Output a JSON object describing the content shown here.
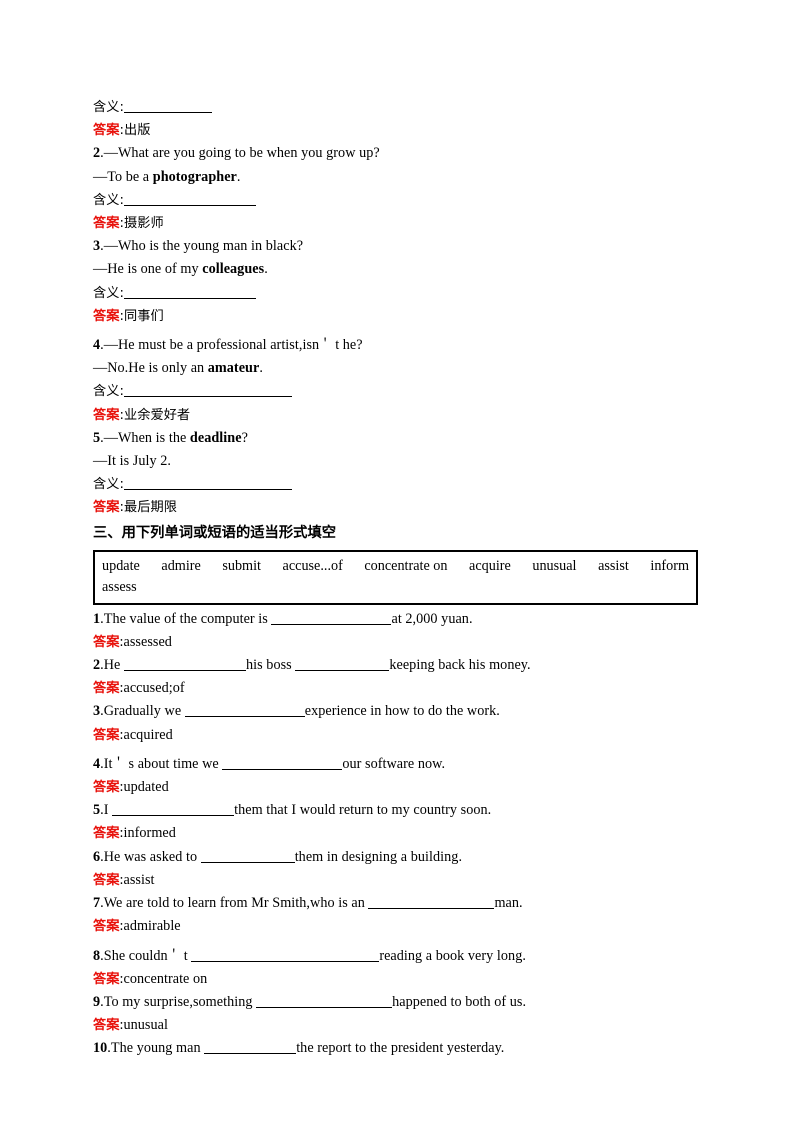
{
  "meaning_label": "含义:",
  "answer_label": "答案",
  "colon": ":",
  "section_two_tail": {
    "q1_answer": "出版"
  },
  "vocab_items": [
    {
      "number": "2",
      "question": ".—What are you going to be when you grow up?",
      "reply_prefix": "—To be a ",
      "reply_bold": "photographer",
      "reply_suffix": ".",
      "answer": "摄影师"
    },
    {
      "number": "3",
      "question": ".—Who is the young man in black?",
      "reply_prefix": "—He is one of my ",
      "reply_bold": "colleagues",
      "reply_suffix": ".",
      "answer": "同事们"
    },
    {
      "number": "4",
      "question_pre": ".—He must be a professional artist,isn",
      "question_post": "t he?",
      "reply_prefix": "—No.He is only an ",
      "reply_bold": "amateur",
      "reply_suffix": ".",
      "answer": "业余爱好者"
    },
    {
      "number": "5",
      "question_pre": ".—When is the ",
      "question_bold": "deadline",
      "question_post": "?",
      "reply_prefix": "—It is July 2.",
      "answer": "最后期限"
    }
  ],
  "section_three": {
    "heading": "三、用下列单词或短语的适当形式填空",
    "word_bank_row1": [
      "update",
      "admire",
      "submit",
      "accuse...of",
      "concentrate on",
      "acquire",
      "unusual",
      "assist",
      "inform"
    ],
    "word_bank_row2": [
      "assess"
    ],
    "questions": [
      {
        "number": "1",
        "pre": ".The value of the computer is ",
        "post": "at 2,000 yuan.",
        "answer": "assessed"
      },
      {
        "number": "2",
        "pre": ".He ",
        "mid": "his boss ",
        "post": "keeping back his money.",
        "answer": "accused;of"
      },
      {
        "number": "3",
        "pre": ".Gradually we ",
        "post": "experience in how to do the work.",
        "answer": "acquired"
      },
      {
        "number": "4",
        "pre_a": ".It",
        "pre_b": "s about time we ",
        "post": "our software now.",
        "answer": "updated"
      },
      {
        "number": "5",
        "pre": ".I ",
        "post": "them that I would return to my country soon.",
        "answer": "informed"
      },
      {
        "number": "6",
        "pre": ".He was asked to ",
        "post": "them in designing a building.",
        "answer": "assist"
      },
      {
        "number": "7",
        "pre": ".We are told to learn from Mr Smith,who is an ",
        "post": "man.",
        "answer": "admirable"
      },
      {
        "number": "8",
        "pre_a": ".She couldn",
        "pre_b": "t ",
        "post": "reading a book very long.",
        "answer": "concentrate on"
      },
      {
        "number": "9",
        "pre": ".To my surprise,something ",
        "post": "happened to both of us.",
        "answer": "unusual"
      },
      {
        "number": "10",
        "pre": ".The young man ",
        "post": "the report to the president yesterday.",
        "answer": ""
      }
    ]
  },
  "apostrophe": "＇"
}
